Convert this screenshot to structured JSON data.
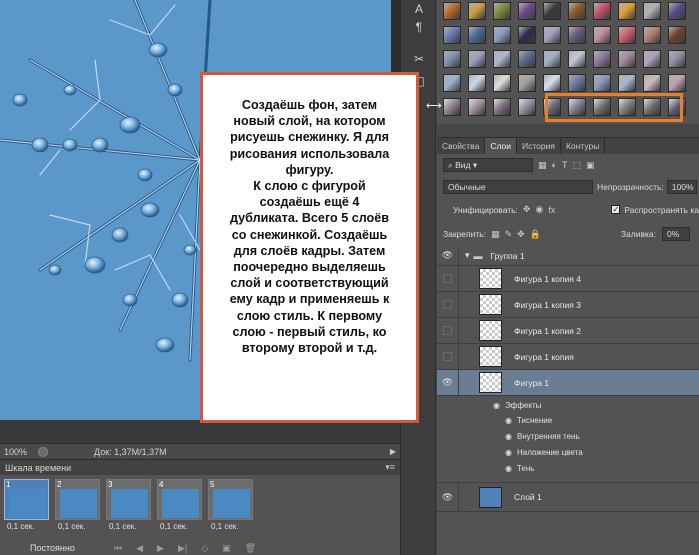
{
  "canvas": {
    "zoom": "100%",
    "doc_info": "Док: 1,37M/1,37M"
  },
  "timeline": {
    "title": "Шкала времени",
    "loop": "Постоянно",
    "frames": [
      {
        "number": "1",
        "delay": "0,1 сек."
      },
      {
        "number": "2",
        "delay": "0,1 сек."
      },
      {
        "number": "3",
        "delay": "0,1 сек."
      },
      {
        "number": "4",
        "delay": "0,1 сек."
      },
      {
        "number": "5",
        "delay": "0,1 сек."
      }
    ]
  },
  "note": {
    "text": "Создаёшь фон, затем\nновый слой, на котором\nрисуешь снежинку. Я для\nрисования использовала\nфигуру.\nК слою с фигурой\nсоздаёшь ещё 4\nдубликата. Всего 5 слоёв\nсо снежинкой. Создаёшь\nдля слоёв кадры. Затем\nпоочередно выделяешь\nслой и соответствующий\nему кадр и применяешь к\nслою стиль. К первому\nслою - первый стиль, ко\nвторому второй и т.д."
  },
  "panel": {
    "tabs": [
      "Свойства",
      "Слои",
      "История",
      "Контуры"
    ],
    "active_tab": "Слои",
    "filter_kind": "Вид",
    "blend_mode": "Обычные",
    "opacity_label": "Непрозрачность:",
    "opacity_value": "100%",
    "unify_label": "Унифицировать:",
    "propagate_label": "Распространять кадр",
    "lock_label": "Закрепить:",
    "fill_label": "Заливка:",
    "fill_value": "0%"
  },
  "layers": {
    "group": "Группа 1",
    "items": [
      {
        "name": "Фигура 1 копия 4"
      },
      {
        "name": "Фигура 1 копия 3"
      },
      {
        "name": "Фигура 1 копия 2"
      },
      {
        "name": "Фигура 1 копия"
      },
      {
        "name": "Фигура 1"
      }
    ],
    "effects_label": "Эффекты",
    "effects": [
      "Тиснение",
      "Внутренняя тень",
      "Наложение цвета",
      "Тень"
    ],
    "background": "Слой 1"
  },
  "colors": {
    "canvas_bg": "#5b97c9",
    "highlight": "#e97e2a",
    "note_border": "#d25a3a"
  }
}
